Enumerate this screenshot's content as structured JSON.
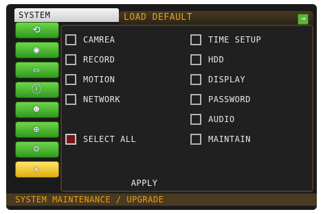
{
  "header": {
    "system_tab": "SYSTEM",
    "load_default_tab": "LOAD DEFAULT",
    "corner_icon": "exit-icon"
  },
  "sidebar": {
    "items": [
      {
        "icon": "network-icon",
        "active": false
      },
      {
        "icon": "disk-icon",
        "active": false
      },
      {
        "icon": "display-icon",
        "active": false
      },
      {
        "icon": "info-icon",
        "active": false
      },
      {
        "icon": "user-icon",
        "active": false
      },
      {
        "icon": "globe-icon",
        "active": false
      },
      {
        "icon": "users-icon",
        "active": false
      },
      {
        "icon": "tools-icon",
        "active": true
      }
    ]
  },
  "options": {
    "left": [
      {
        "label": "CAMREA",
        "checked": false
      },
      {
        "label": "RECORD",
        "checked": false
      },
      {
        "label": "MOTION",
        "checked": false
      },
      {
        "label": "NETWORK",
        "checked": false
      }
    ],
    "right": [
      {
        "label": "TIME SETUP",
        "checked": false
      },
      {
        "label": "HDD",
        "checked": false
      },
      {
        "label": "DISPLAY",
        "checked": false
      },
      {
        "label": "PASSWORD",
        "checked": false
      },
      {
        "label": "AUDIO",
        "checked": false
      },
      {
        "label": "MAINTAIN",
        "checked": false
      }
    ],
    "select_all": {
      "label": "SELECT ALL",
      "checked": false
    }
  },
  "apply_label": "APPLY",
  "status_text": "SYSTEM MAINTENANCE / UPGRADE",
  "colors": {
    "accent": "#e8a020",
    "panel_border": "#4a3a24",
    "sidebar_green": "#4fbd32",
    "sidebar_active": "#f3c82c",
    "select_all_box": "#7a1515"
  }
}
